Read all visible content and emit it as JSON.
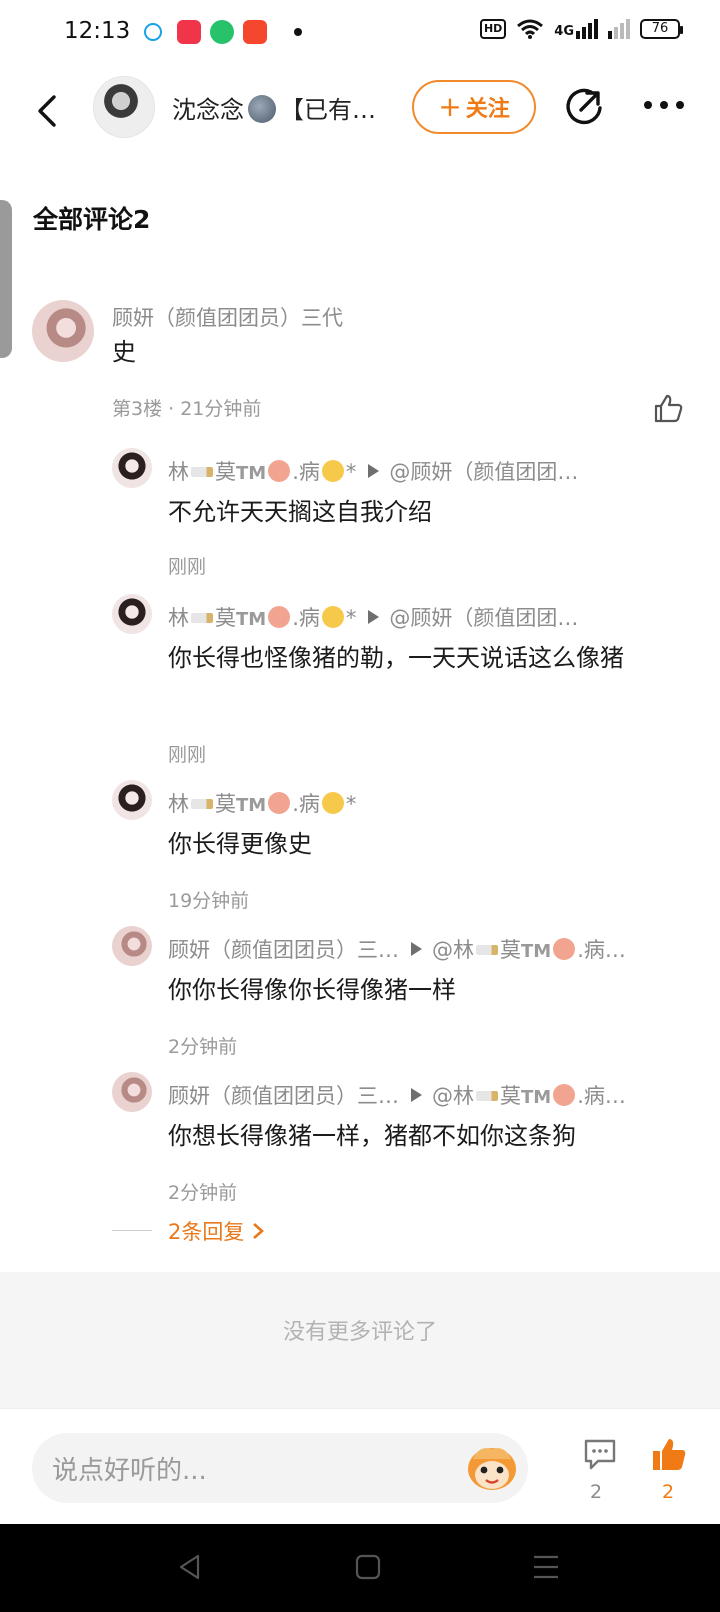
{
  "status": {
    "time": "12:13",
    "hd": "HD",
    "net": "4G",
    "battery": "76"
  },
  "header": {
    "username_prefix": "沈念念",
    "username_suffix": "【已有…",
    "follow_label": "关注",
    "follow_plus": "+"
  },
  "section": {
    "title": "全部评论2"
  },
  "main_comment": {
    "name": "顾妍（颜值团团员）三代",
    "text": "史",
    "meta": "第3楼 · 21分钟前"
  },
  "replies": [
    {
      "name": "林",
      "name2": "莫",
      "tm": "TM",
      "name3": ".病",
      "suffix": "*",
      "to": "@顾妍（颜值团团…",
      "text": "不允许天天搁这自我介绍",
      "time": "刚刚"
    },
    {
      "name": "林",
      "name2": "莫",
      "tm": "TM",
      "name3": ".病",
      "suffix": "*",
      "to": "@顾妍（颜值团团…",
      "text": "你长得也怪像猪的勒，一天天说话这么像猪",
      "time": "刚刚"
    },
    {
      "name": "林",
      "name2": "莫",
      "tm": "TM",
      "name3": ".病",
      "suffix": "*",
      "to": "",
      "text": "你长得更像史",
      "time": "19分钟前"
    },
    {
      "name": "顾妍（颜值团团员）三…",
      "to": "@林",
      "to2": "莫",
      "tm": "TM",
      "to3": ".病…",
      "text": "你你长得像你长得像猪一样",
      "time": "2分钟前"
    },
    {
      "name": "顾妍（颜值团团员）三…",
      "to": "@林",
      "to2": "莫",
      "tm": "TM",
      "to3": ".病…",
      "text": "你想长得像猪一样，猪都不如你这条狗",
      "time": "2分钟前"
    }
  ],
  "more_replies": "2条回复",
  "no_more": "没有更多评论了",
  "bottom": {
    "placeholder": "说点好听的...",
    "comment_count": "2",
    "like_count": "2"
  },
  "colors": {
    "accent": "#f07a14",
    "gray_text": "#8c8c8c"
  }
}
